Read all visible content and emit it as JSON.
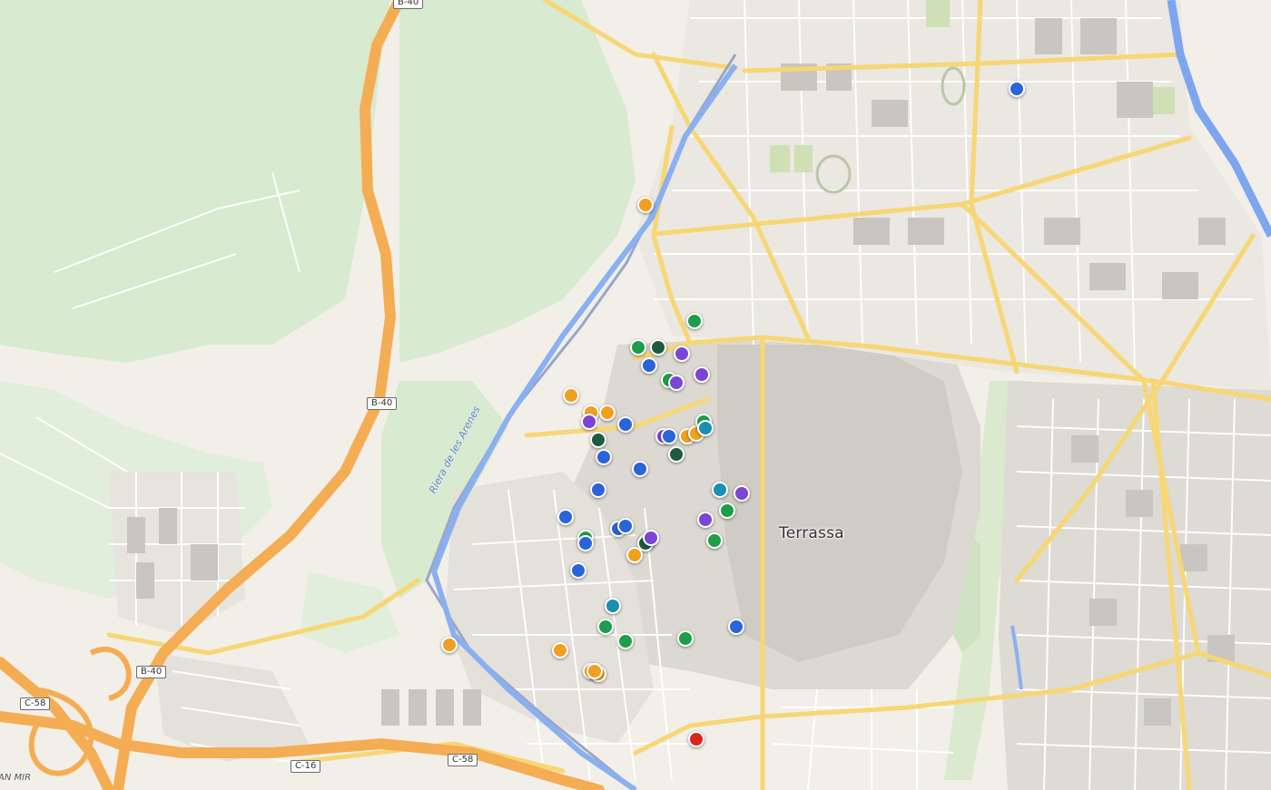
{
  "map": {
    "city_label": "Terrassa",
    "river_label": "Riera de les Arenes",
    "edge_place_label": "AN MIR",
    "road_shields": [
      "B-40",
      "B-40",
      "B-40",
      "C-58",
      "C-16",
      "C-58"
    ]
  },
  "marker_colors": {
    "blue": "#2b63d9",
    "orange": "#f0a021",
    "green": "#1e9e4a",
    "dark_green": "#1d5c3a",
    "purple": "#7b45d6",
    "teal": "#1b8fb0",
    "red": "#d9261c"
  },
  "markers": [
    {
      "category": "blue",
      "lng": 2.0212,
      "lat": 41.5752
    },
    {
      "category": "orange",
      "lng": 2.0007,
      "lat": 41.5713
    },
    {
      "category": "orange",
      "lng": 1.9966,
      "lat": 41.5649
    },
    {
      "category": "orange",
      "lng": 1.9977,
      "lat": 41.5643
    },
    {
      "category": "orange",
      "lng": 1.9986,
      "lat": 41.5643
    },
    {
      "category": "purple",
      "lng": 1.9976,
      "lat": 41.564
    },
    {
      "category": "dark_green",
      "lng": 1.9981,
      "lat": 41.5634
    },
    {
      "category": "blue",
      "lng": 1.9984,
      "lat": 41.5628
    },
    {
      "category": "blue",
      "lng": 1.9996,
      "lat": 41.5639
    },
    {
      "category": "green",
      "lng": 2.0003,
      "lat": 41.5665
    },
    {
      "category": "blue",
      "lng": 2.0009,
      "lat": 41.5659
    },
    {
      "category": "dark_green",
      "lng": 2.0014,
      "lat": 41.5665
    },
    {
      "category": "purple",
      "lng": 2.0027,
      "lat": 41.5663
    },
    {
      "category": "green",
      "lng": 2.0034,
      "lat": 41.5674
    },
    {
      "category": "green",
      "lng": 2.002,
      "lat": 41.5654
    },
    {
      "category": "purple",
      "lng": 2.0024,
      "lat": 41.5653
    },
    {
      "category": "purple",
      "lng": 2.0038,
      "lat": 41.5656
    },
    {
      "category": "purple",
      "lng": 2.0017,
      "lat": 41.5635
    },
    {
      "category": "blue",
      "lng": 2.002,
      "lat": 41.5635
    },
    {
      "category": "orange",
      "lng": 2.003,
      "lat": 41.5635
    },
    {
      "category": "orange",
      "lng": 2.0035,
      "lat": 41.5636
    },
    {
      "category": "green",
      "lng": 2.0039,
      "lat": 41.564
    },
    {
      "category": "teal",
      "lng": 2.004,
      "lat": 41.5638
    },
    {
      "category": "dark_green",
      "lng": 2.0024,
      "lat": 41.5629
    },
    {
      "category": "blue",
      "lng": 2.0004,
      "lat": 41.5624
    },
    {
      "category": "blue",
      "lng": 1.9981,
      "lat": 41.5617
    },
    {
      "category": "teal",
      "lng": 2.0048,
      "lat": 41.5617
    },
    {
      "category": "purple",
      "lng": 2.006,
      "lat": 41.5616
    },
    {
      "category": "green",
      "lng": 2.0052,
      "lat": 41.561
    },
    {
      "category": "purple",
      "lng": 2.004,
      "lat": 41.5607
    },
    {
      "category": "green",
      "lng": 2.0045,
      "lat": 41.56
    },
    {
      "category": "blue",
      "lng": 1.9963,
      "lat": 41.5608
    },
    {
      "category": "blue",
      "lng": 1.9992,
      "lat": 41.5604
    },
    {
      "category": "blue",
      "lng": 1.9996,
      "lat": 41.5605
    },
    {
      "category": "green",
      "lng": 2.0008,
      "lat": 41.56
    },
    {
      "category": "dark_green",
      "lng": 2.0007,
      "lat": 41.5599
    },
    {
      "category": "purple",
      "lng": 2.001,
      "lat": 41.5601
    },
    {
      "category": "green",
      "lng": 1.9974,
      "lat": 41.5601
    },
    {
      "category": "blue",
      "lng": 1.9974,
      "lat": 41.5599
    },
    {
      "category": "orange",
      "lng": 2.0001,
      "lat": 41.5595
    },
    {
      "category": "blue",
      "lng": 1.997,
      "lat": 41.559
    },
    {
      "category": "teal",
      "lng": 1.9989,
      "lat": 41.5578
    },
    {
      "category": "green",
      "lng": 1.9985,
      "lat": 41.5571
    },
    {
      "category": "green",
      "lng": 1.9996,
      "lat": 41.5566
    },
    {
      "category": "green",
      "lng": 2.0029,
      "lat": 41.5567
    },
    {
      "category": "blue",
      "lng": 2.0057,
      "lat": 41.5571
    },
    {
      "category": "orange",
      "lng": 1.9899,
      "lat": 41.5565
    },
    {
      "category": "orange",
      "lng": 1.996,
      "lat": 41.5563
    },
    {
      "category": "orange",
      "lng": 1.9977,
      "lat": 41.5556
    },
    {
      "category": "orange",
      "lng": 1.9981,
      "lat": 41.5555
    },
    {
      "category": "orange",
      "lng": 1.9979,
      "lat": 41.5556
    },
    {
      "category": "red",
      "lng": 2.0035,
      "lat": 41.5533
    }
  ]
}
